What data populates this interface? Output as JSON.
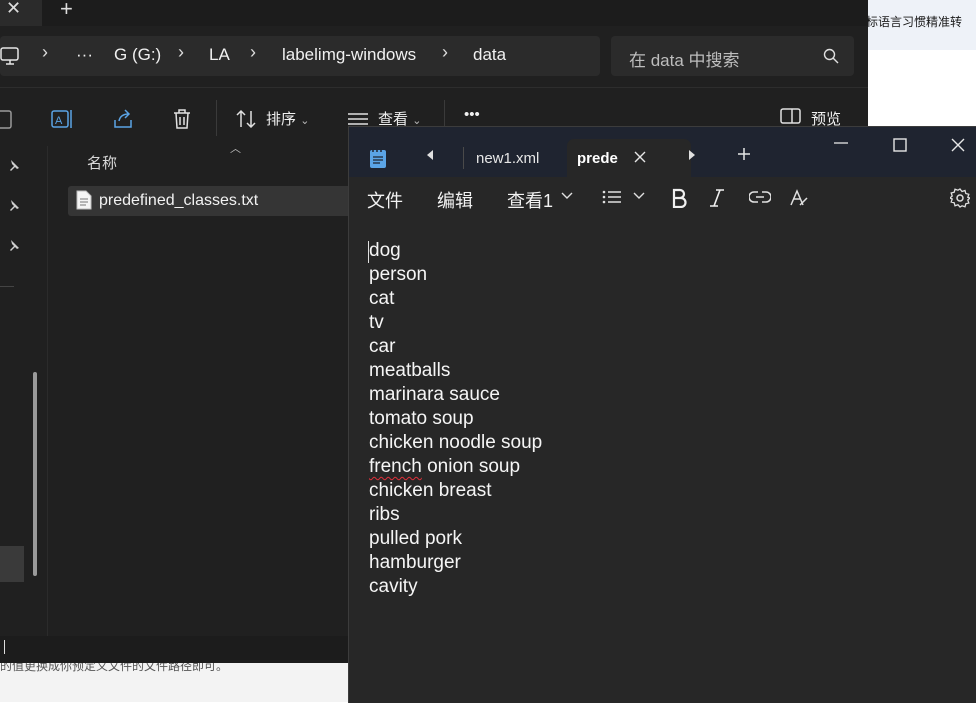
{
  "background_page": {
    "hint_text": "标语言习惯精准转",
    "footer_text": "的值更换成你预定义文件的文件路径即可。"
  },
  "explorer": {
    "tab_close_glyph": "✕",
    "new_tab_glyph": "+",
    "breadcrumb": {
      "more": "···",
      "items": [
        "G (G:)",
        "LA",
        "labelimg-windows",
        "data"
      ]
    },
    "search_placeholder": "在 data 中搜索",
    "toolbar": {
      "sort_label": "排序",
      "view_label": "查看",
      "more_glyph": "•••",
      "preview_label": "预览"
    },
    "column_name_header": "名称",
    "files": [
      {
        "name": "predefined_classes.txt",
        "icon": "text-file-icon"
      }
    ]
  },
  "notepad": {
    "tabs": [
      {
        "label": "new1.xml",
        "active": false
      },
      {
        "label": "prede",
        "active": true
      }
    ],
    "menu": {
      "file": "文件",
      "edit": "编辑",
      "view": "查看1"
    },
    "lines": [
      "dog",
      "person",
      "cat",
      "tv",
      "car",
      "meatballs",
      "marinara sauce",
      "tomato soup",
      "chicken noodle soup",
      "french onion soup",
      "chicken breast",
      "ribs",
      "pulled pork",
      "hamburger",
      "cavity"
    ],
    "misspelled_word": "french"
  },
  "colors": {
    "explorer_bg": "#202020",
    "notepad_bg": "#272727",
    "notepad_titlebar": "#1f2430",
    "notepad_icon_accent": "#5ba4e6",
    "spellcheck": "#e0303a"
  }
}
